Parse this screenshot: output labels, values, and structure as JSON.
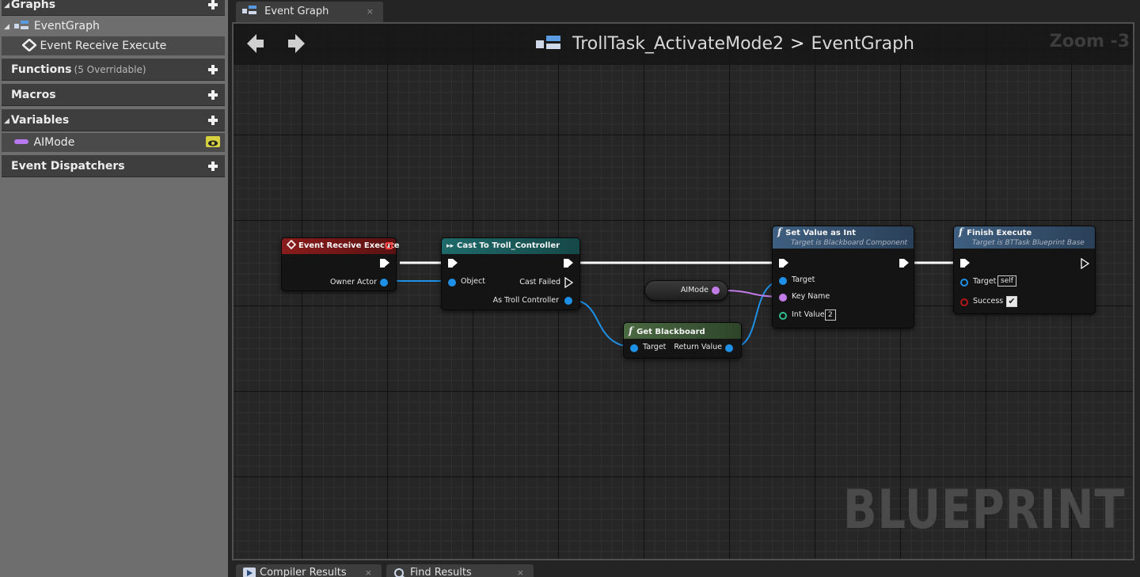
{
  "my_blueprint": {
    "graphs": {
      "label": "Graphs",
      "items": [
        {
          "label": "EventGraph"
        },
        {
          "label": "Event Receive Execute"
        }
      ]
    },
    "functions": {
      "label": "Functions",
      "sub": "(5 Overridable)"
    },
    "macros": {
      "label": "Macros"
    },
    "variables": {
      "label": "Variables",
      "items": [
        {
          "label": "AIMode",
          "color": "#b879f0"
        }
      ]
    },
    "event_dispatchers": {
      "label": "Event Dispatchers"
    }
  },
  "editor": {
    "tab": {
      "label": "Event Graph",
      "close": "×"
    },
    "breadcrumb": {
      "blueprint": "TrollTask_ActivateMode2",
      "separator": ">",
      "graph": "EventGraph"
    },
    "zoom": "Zoom -3",
    "watermark": "BLUEPRINT"
  },
  "nodes": {
    "event_receive_execute": {
      "title": "Event Receive Execute",
      "pins": {
        "owner_actor": "Owner Actor"
      },
      "color": "#7d1a1a"
    },
    "cast_to_troll_controller": {
      "title": "Cast To Troll_Controller",
      "pins": {
        "object": "Object",
        "cast_failed": "Cast Failed",
        "as_troll_controller": "As Troll Controller"
      },
      "color": "#1e5a5a"
    },
    "aimode_getter": {
      "label": "AIMode"
    },
    "get_blackboard": {
      "title": "Get Blackboard",
      "pins": {
        "target": "Target",
        "return_value": "Return Value"
      },
      "color": "#3f5a3a"
    },
    "set_value_as_int": {
      "title": "Set Value as Int",
      "subtitle": "Target is Blackboard Component",
      "pins": {
        "target": "Target",
        "key_name": "Key Name",
        "int_value": "Int Value"
      },
      "int_value": "2",
      "color": "#3d5a7a"
    },
    "finish_execute": {
      "title": "Finish Execute",
      "subtitle": "Target is BTTask Blueprint Base",
      "pins": {
        "target": "Target",
        "success": "Success"
      },
      "target_value": "self",
      "success_checked": "✔",
      "color": "#3d5a7a"
    }
  },
  "bottom_tabs": [
    {
      "label": "Compiler Results"
    },
    {
      "label": "Find Results"
    }
  ]
}
